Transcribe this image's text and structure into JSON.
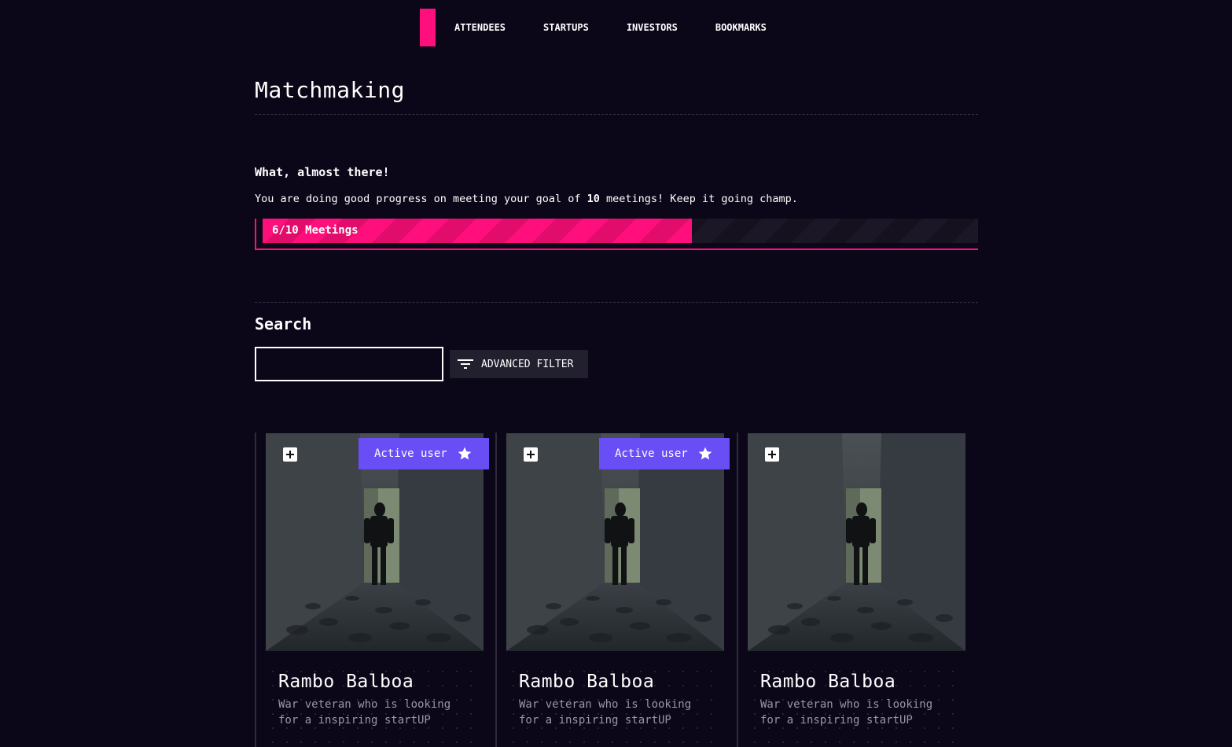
{
  "nav": {
    "items": [
      {
        "label": "ATTENDEES"
      },
      {
        "label": "STARTUPS"
      },
      {
        "label": "INVESTORS"
      },
      {
        "label": "BOOKMARKS"
      }
    ]
  },
  "page": {
    "title": "Matchmaking"
  },
  "progress": {
    "heading": "What, almost there!",
    "text_before": "You are doing good progress on meeting your goal of ",
    "goal": "10",
    "text_after": " meetings! Keep it going champ.",
    "label": "6/10 Meetings",
    "current": 6,
    "total": 10
  },
  "search": {
    "heading": "Search",
    "input_value": "",
    "filter_label": "ADVANCED FILTER"
  },
  "colors": {
    "accent": "#ff0f7b",
    "badge": "#6a4ef5",
    "background": "#0b0719"
  },
  "cards": [
    {
      "name": "Rambo Balboa",
      "description": "War veteran who is looking for a inspiring startUP",
      "badge": "Active user",
      "active": true
    },
    {
      "name": "Rambo Balboa",
      "description": "War veteran who is looking for a inspiring startUP",
      "badge": "Active user",
      "active": true
    },
    {
      "name": "Rambo Balboa",
      "description": "War veteran who is looking for a inspiring startUP",
      "badge": "",
      "active": false
    }
  ]
}
